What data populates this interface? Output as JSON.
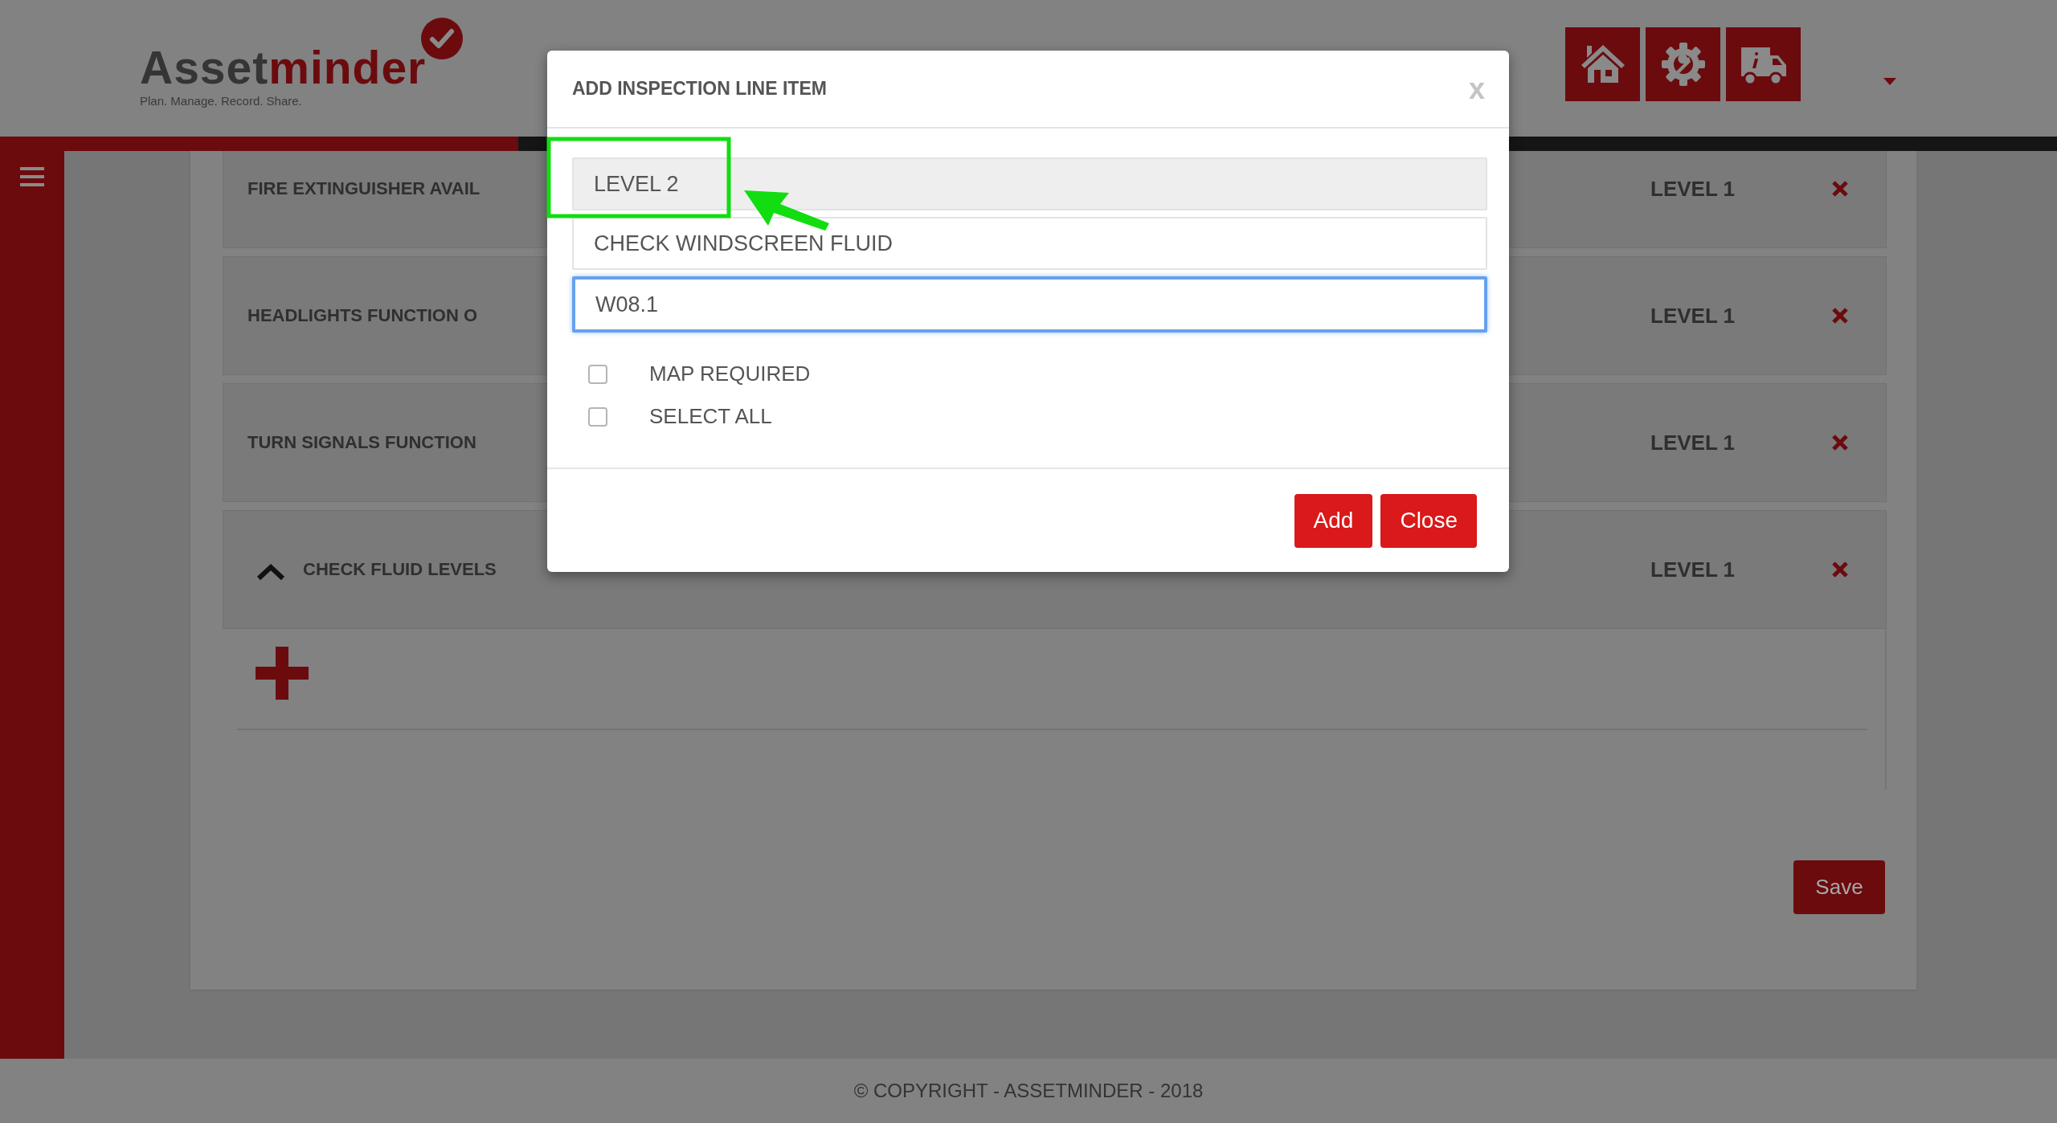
{
  "header": {
    "logo": {
      "prefix": "Asset",
      "suffix": "minder",
      "tagline": "Plan. Manage. Record. Share."
    },
    "nav_buttons": [
      {
        "kind": "home"
      },
      {
        "kind": "settings"
      },
      {
        "kind": "vehicle"
      }
    ]
  },
  "items": [
    {
      "title": "FIRE EXTINGUISHER AVAIL",
      "level_label": "LEVEL 1",
      "expanded": false
    },
    {
      "title": "HEADLIGHTS FUNCTION O",
      "level_label": "LEVEL 1",
      "expanded": false
    },
    {
      "title": "TURN SIGNALS FUNCTION",
      "level_label": "LEVEL 1",
      "expanded": false
    },
    {
      "title": "CHECK FLUID LEVELS",
      "level_label": "LEVEL 1",
      "expanded": true
    }
  ],
  "save_button": "Save",
  "footer": "© COPYRIGHT - ASSETMINDER - 2018",
  "dialog": {
    "title": "ADD INSPECTION LINE ITEM",
    "close_glyph": "x",
    "fields": [
      {
        "value": "LEVEL 2",
        "readonly": true,
        "focused": false
      },
      {
        "value": "CHECK WINDSCREEN FLUID",
        "readonly": false,
        "focused": false
      },
      {
        "value": "W08.1",
        "readonly": false,
        "focused": true
      }
    ],
    "checkboxes": [
      {
        "label": "MAP REQUIRED",
        "checked": false
      },
      {
        "label": "SELECT ALL",
        "checked": false
      }
    ],
    "buttons": [
      "Add",
      "Close"
    ]
  }
}
